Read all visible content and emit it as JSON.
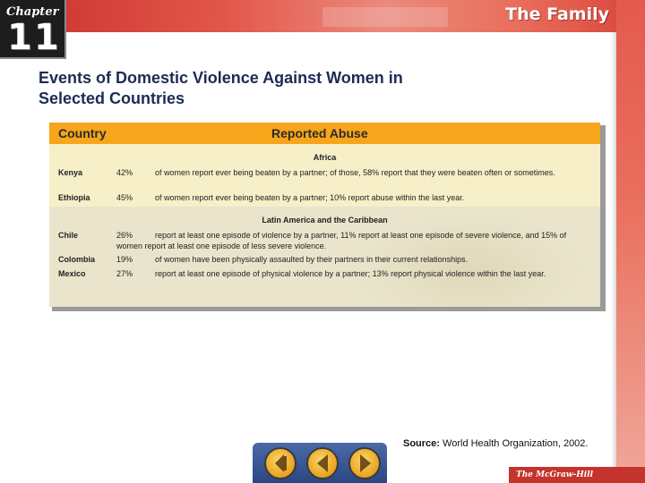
{
  "header": {
    "chapter_word": "Chapter",
    "chapter_number": "11",
    "unit_title": "The Family"
  },
  "slide": {
    "title_line1": "Events of Domestic Violence Against Women in",
    "title_line2": "Selected Countries"
  },
  "table": {
    "headers": {
      "country": "Country",
      "abuse": "Reported Abuse"
    },
    "regions": [
      {
        "name": "Africa",
        "rows": [
          {
            "country": "Kenya",
            "pct": "42%",
            "desc": "of women report ever being beaten by a partner; of those, 58% report that they were beaten often or sometimes."
          },
          {
            "country": "Ethiopia",
            "pct": "45%",
            "desc": "of women report ever being beaten by a partner; 10% report abuse within the last year."
          }
        ]
      },
      {
        "name": "Latin America and the Caribbean",
        "rows": [
          {
            "country": "Chile",
            "pct": "26%",
            "desc": "report at least one episode of violence by a partner, 11% report at least one episode of severe violence, and 15% of women report at least one episode of less severe violence."
          },
          {
            "country": "Colombia",
            "pct": "19%",
            "desc": "of women have been physically assaulted by their partners in their current relationships."
          },
          {
            "country": "Mexico",
            "pct": "27%",
            "desc": "report at least one episode of physical violence by a partner; 13% report physical violence within the last year."
          }
        ]
      }
    ]
  },
  "source": {
    "label": "Source:",
    "text": "World Health Organization, 2002."
  },
  "nav": {
    "home_icon": "home-icon",
    "back_icon": "back-arrow-icon",
    "forward_icon": "forward-arrow-icon"
  },
  "footer": {
    "publisher": "The McGraw-Hill Companies"
  },
  "colors": {
    "header_red": "#d8443a",
    "table_header_orange": "#f7a51a",
    "title_navy": "#1f2a55",
    "card_cream": "#f6efc8"
  }
}
